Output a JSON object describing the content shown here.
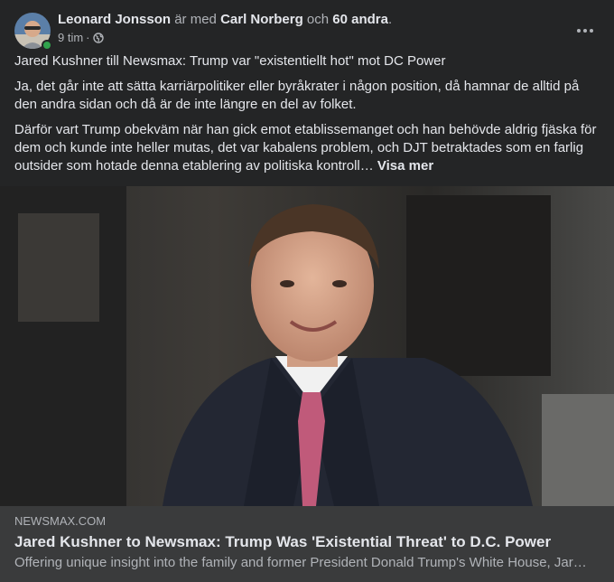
{
  "post": {
    "author": "Leonard Jonsson",
    "with_word": "är med",
    "tagged": "Carl Norberg",
    "and_word": "och",
    "others": "60 andra",
    "period": ".",
    "time": "9 tim",
    "dot": "·",
    "privacy_icon": "globe-icon",
    "more_icon": "more-options-icon",
    "paragraphs": [
      "Jared Kushner till Newsmax: Trump var \"existentiellt hot\" mot DC Power",
      "Ja,  det går inte att sätta karriärpolitiker eller byråkrater i någon position, då hamnar de alltid på den andra sidan och då är de inte längre en del av folket.",
      "Därför vart Trump obekväm när han gick emot etablissemanget och han behövde aldrig fjäska för dem och kunde inte heller mutas, det var kabalens problem, och DJT betraktades som en farlig outsider som hotade denna etablering av politiska kontroll…"
    ],
    "see_more": "Visa mer"
  },
  "link": {
    "domain": "NEWSMAX.COM",
    "title": "Jared Kushner to Newsmax: Trump Was 'Existential Threat' to D.C. Power",
    "description": "Offering unique insight into the family and former President Donald Trump's White House, Jar…"
  },
  "colors": {
    "card_bg": "#242526",
    "link_bg": "#3a3b3c",
    "text_primary": "#e4e6eb",
    "text_secondary": "#b0b3b8",
    "online": "#31a24c"
  }
}
